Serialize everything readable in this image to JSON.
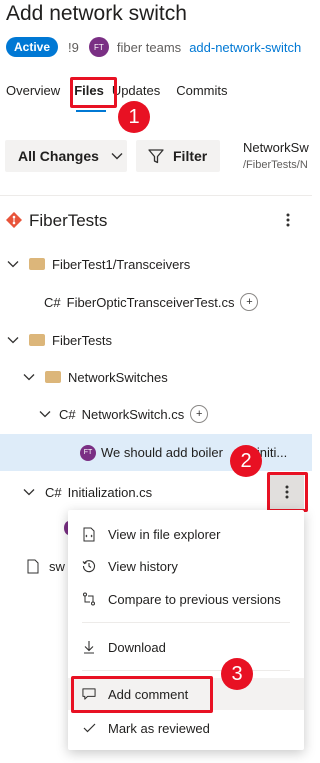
{
  "header": {
    "title": "Add network switch",
    "status": "Active",
    "pr_number": "!9",
    "author_initials": "FT",
    "author": "fiber teams",
    "branch": "add-network-switch"
  },
  "tabs": [
    {
      "label": "Overview"
    },
    {
      "label": "Files"
    },
    {
      "label": "Updates"
    },
    {
      "label": "Commits"
    }
  ],
  "toolbar": {
    "changes_dropdown": "All Changes",
    "filter_label": "Filter",
    "path_title": "NetworkSw",
    "path_sub": "/FiberTests/N"
  },
  "repo": {
    "name": "FiberTests"
  },
  "tree": {
    "folder1": "FiberTest1/Transceivers",
    "file1_lang": "C#",
    "file1": "FiberOpticTransceiverTest.cs",
    "folder2": "FiberTests",
    "folder3": "NetworkSwitches",
    "file2_lang": "C#",
    "file2": "NetworkSwitch.cs",
    "comment_initials": "FT",
    "comment_text": "We should add boiler",
    "comment_text_tail": "initi...",
    "file3_lang": "C#",
    "file3": "Initialization.cs",
    "file4_partial": "sw"
  },
  "context_menu": {
    "items": [
      {
        "label": "View in file explorer"
      },
      {
        "label": "View history"
      },
      {
        "label": "Compare to previous versions"
      },
      {
        "label": "Download"
      },
      {
        "label": "Add comment"
      },
      {
        "label": "Mark as reviewed"
      }
    ]
  },
  "callouts": [
    "1",
    "2",
    "3"
  ],
  "colors": {
    "accent": "#0078d4",
    "callout": "#e81123",
    "selected_row": "#deecf9",
    "folder": "#dcb67a",
    "git_icon": "#e8543a"
  }
}
